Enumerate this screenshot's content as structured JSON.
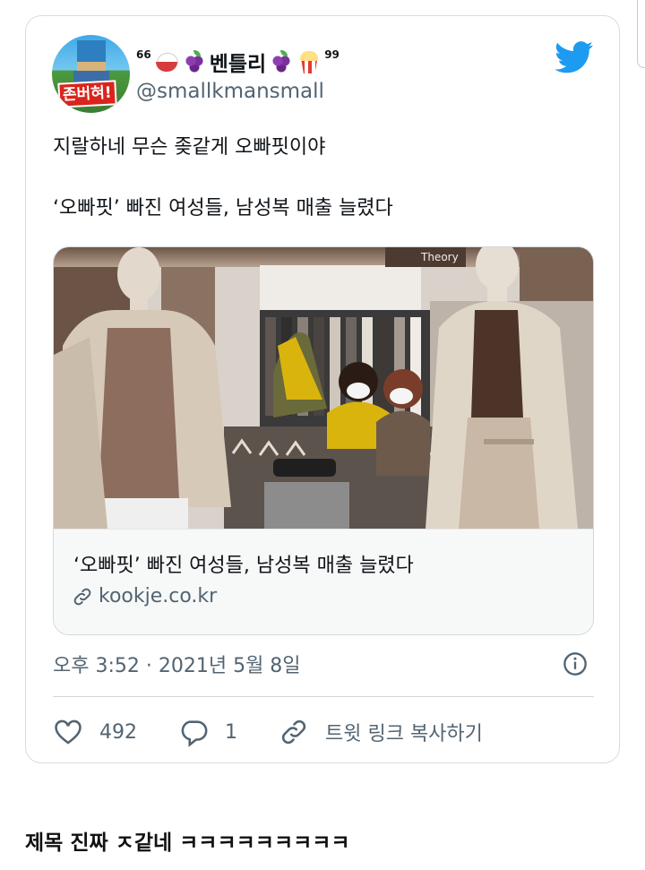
{
  "tweet": {
    "display_name_prefix": "66",
    "display_name": "벤틀리",
    "display_name_suffix": "99",
    "handle": "@smallkmansmall",
    "avatar_badge": "존버혀!",
    "text_lines": [
      "지랄하네 무슨 좆같게 오빠핏이야",
      "‘오빠핏’ 빠진 여성들, 남성복 매출 늘렸다"
    ],
    "link_card": {
      "title": "‘오빠핏’ 빠진 여성들, 남성복 매출 늘렸다",
      "domain": "kookje.co.kr",
      "image_sign_text": "Theory"
    },
    "timestamp": "오후 3:52 · 2021년 5월 8일",
    "actions": {
      "likes": "492",
      "replies": "1",
      "copy_link": "트윗 링크 복사하기"
    }
  },
  "post_comment": "제목 진짜 ㅈ같네 ㅋㅋㅋㅋㅋㅋㅋㅋㅋ",
  "colors": {
    "twitter_blue": "#1d9bf0",
    "text_primary": "#0f1419",
    "text_secondary": "#536471",
    "border": "#cfd9de"
  },
  "icons": [
    "twitter-bird-icon",
    "rice-emoji-icon",
    "grapes-emoji-icon",
    "popcorn-emoji-icon",
    "link-icon",
    "info-icon",
    "heart-icon",
    "reply-icon",
    "copy-link-icon"
  ]
}
